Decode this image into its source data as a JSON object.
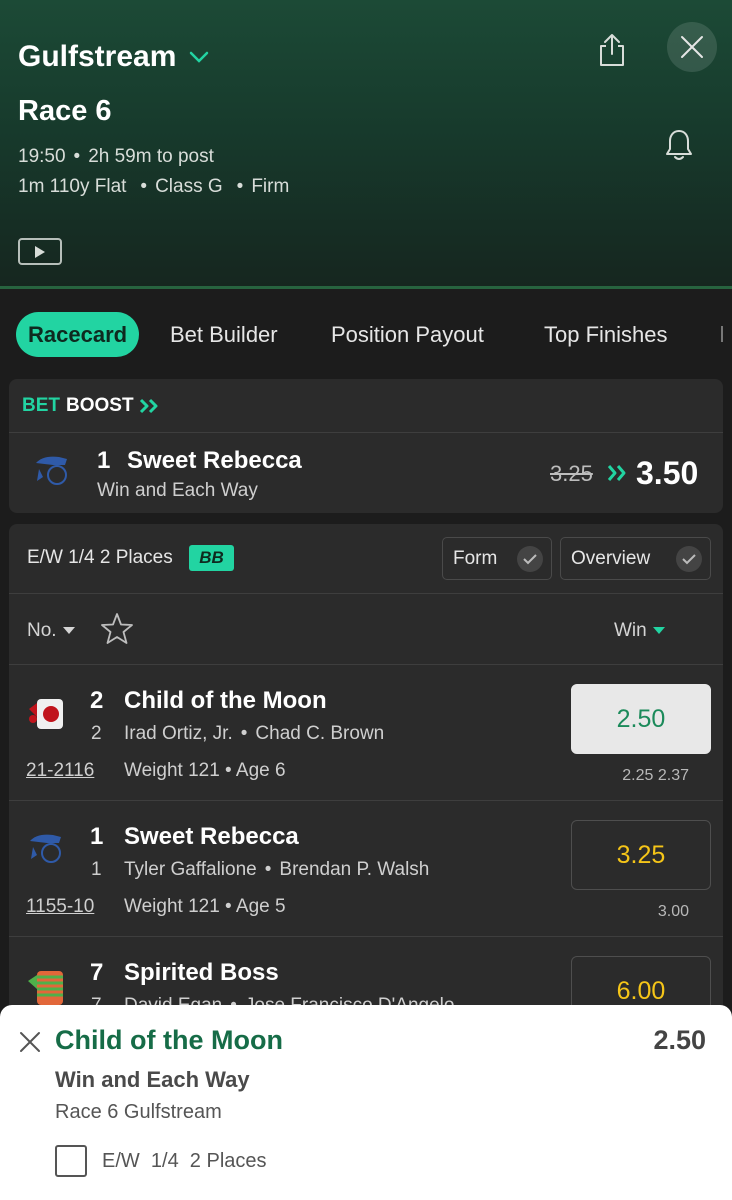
{
  "header": {
    "venue": "Gulfstream",
    "race_name": "Race 6",
    "time": "19:50",
    "countdown": "2h 59m to post",
    "distance_type": "1m 110y Flat",
    "class": "Class G",
    "going": "Firm"
  },
  "tabs": [
    "Racecard",
    "Bet Builder",
    "Position Payout",
    "Top Finishes"
  ],
  "bet_boost": {
    "label_bet": "BET",
    "label_boost": "BOOST",
    "number": "1",
    "horse": "Sweet Rebecca",
    "market": "Win and Each Way",
    "old_odds": "3.25",
    "new_odds": "3.50"
  },
  "racecard": {
    "ew_terms": "E/W 1/4 2 Places",
    "bb_badge": "BB",
    "form_label": "Form",
    "overview_label": "Overview",
    "col_no": "No.",
    "col_win": "Win",
    "runners": [
      {
        "number": "2",
        "name": "Child of the Moon",
        "draw": "2",
        "jockey": "Irad Ortiz, Jr.",
        "trainer": "Chad C. Brown",
        "form": "21-2116",
        "weight_age": "Weight 121 • Age 6",
        "odds": "2.50",
        "prev_odds": "2.25  2.37"
      },
      {
        "number": "1",
        "name": "Sweet Rebecca",
        "draw": "1",
        "jockey": "Tyler Gaffalione",
        "trainer": "Brendan P. Walsh",
        "form": "1155-10",
        "weight_age": "Weight 121 • Age 5",
        "odds": "3.25",
        "prev_odds": "3.00"
      },
      {
        "number": "7",
        "name": "Spirited Boss",
        "draw": "7",
        "jockey": "David Egan",
        "trainer": "Jose Francisco D'Angelo",
        "odds": "6.00"
      }
    ]
  },
  "bet_slip": {
    "horse": "Child of the Moon",
    "odds": "2.50",
    "market": "Win and Each Way",
    "race": "Race 6 Gulfstream",
    "ew_option": "E/W  1/4  2 Places"
  },
  "colors": {
    "accent": "#22d4a2",
    "odds_text": "#f5c518",
    "selected_green": "#1b8a5a"
  },
  "icons": [
    "chevron-down-icon",
    "share-icon",
    "close-icon",
    "bell-icon",
    "play-icon",
    "double-chevron-icon",
    "checkmark-icon",
    "star-icon",
    "caret-down-icon",
    "jockey-silk-icon",
    "checkbox-icon"
  ]
}
